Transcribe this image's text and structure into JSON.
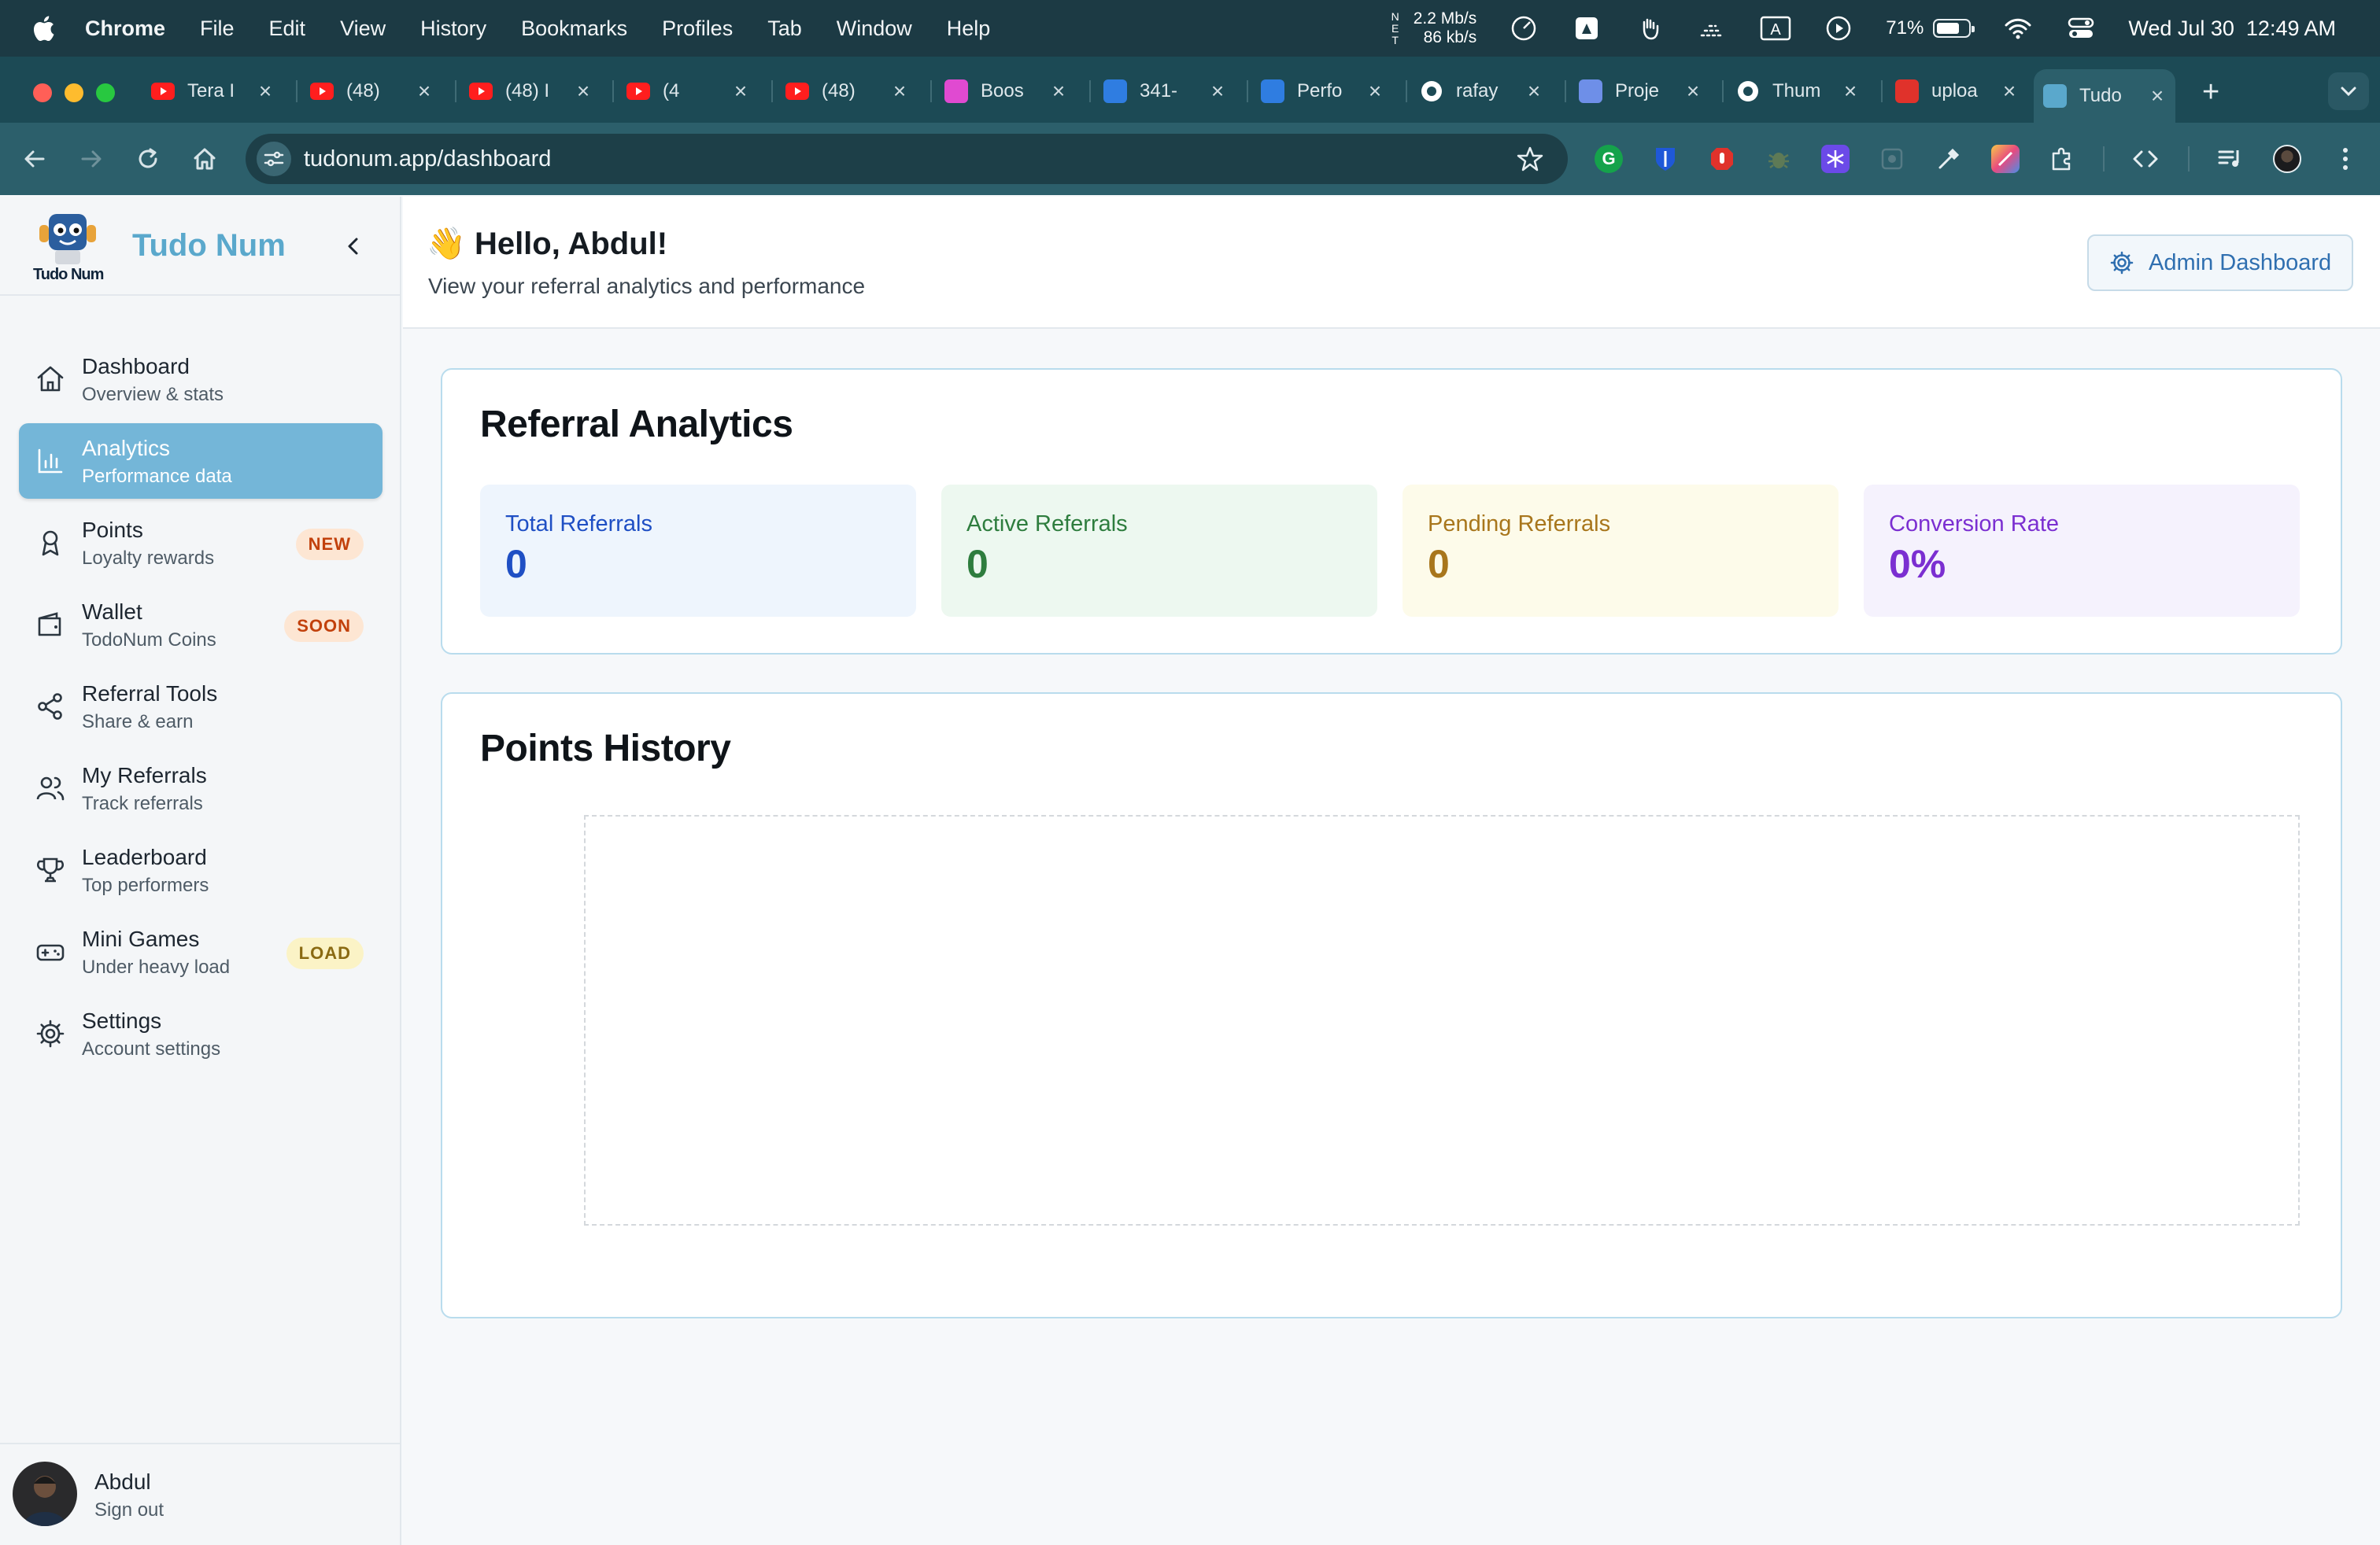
{
  "menubar": {
    "app": "Chrome",
    "items": [
      "File",
      "Edit",
      "View",
      "History",
      "Bookmarks",
      "Profiles",
      "Tab",
      "Window",
      "Help"
    ],
    "net_letters": "N\nE\nT",
    "net_down": "2.2 Mb/s",
    "net_up": "86 kb/s",
    "battery": "71%",
    "battery_level": 0.71,
    "datetime": "Wed Jul 30  12:49 AM"
  },
  "tabs": [
    {
      "title": "Tera I",
      "icon": "youtube-icon"
    },
    {
      "title": "(48) ",
      "icon": "youtube-icon"
    },
    {
      "title": "(48) I",
      "icon": "youtube-icon"
    },
    {
      "title": "(4",
      "icon": "youtube-icon"
    },
    {
      "title": "(48) ",
      "icon": "youtube-icon"
    },
    {
      "title": "Boos",
      "icon": "chat-bubble-icon"
    },
    {
      "title": "341-",
      "icon": "google-ads-icon"
    },
    {
      "title": "Perfo",
      "icon": "analytics-icon"
    },
    {
      "title": "rafay",
      "icon": "github-icon"
    },
    {
      "title": "Proje",
      "icon": "project-icon"
    },
    {
      "title": "Thum",
      "icon": "openai-icon"
    },
    {
      "title": "uploa",
      "icon": "upload-app-icon"
    },
    {
      "title": "Tudo",
      "icon": "tudonum-icon"
    }
  ],
  "toolbar": {
    "url": "tudonum.app/dashboard"
  },
  "sidebar": {
    "brand": "Tudo Num",
    "logo_text": "Tudo Num",
    "items": [
      {
        "title": "Dashboard",
        "subtitle": "Overview & stats",
        "icon": "home-icon",
        "badge": ""
      },
      {
        "title": "Analytics",
        "subtitle": "Performance data",
        "icon": "bar-chart-icon",
        "badge": ""
      },
      {
        "title": "Points",
        "subtitle": "Loyalty rewards",
        "icon": "award-icon",
        "badge": "NEW"
      },
      {
        "title": "Wallet",
        "subtitle": "TodoNum Coins",
        "icon": "wallet-icon",
        "badge": "SOON"
      },
      {
        "title": "Referral Tools",
        "subtitle": "Share & earn",
        "icon": "share-icon",
        "badge": ""
      },
      {
        "title": "My Referrals",
        "subtitle": "Track referrals",
        "icon": "users-icon",
        "badge": ""
      },
      {
        "title": "Leaderboard",
        "subtitle": "Top performers",
        "icon": "trophy-icon",
        "badge": ""
      },
      {
        "title": "Mini Games",
        "subtitle": "Under heavy load",
        "icon": "gamepad-icon",
        "badge": "LOAD"
      },
      {
        "title": "Settings",
        "subtitle": "Account settings",
        "icon": "gear-icon",
        "badge": ""
      }
    ],
    "user": {
      "name": "Abdul",
      "action": "Sign out"
    }
  },
  "header": {
    "greeting_emoji": "👋",
    "greeting": "Hello, Abdul!",
    "subtitle": "View your referral analytics and performance",
    "admin_button": "Admin Dashboard"
  },
  "referral_analytics": {
    "title": "Referral Analytics",
    "stats": [
      {
        "label": "Total Referrals",
        "value": "0"
      },
      {
        "label": "Active Referrals",
        "value": "0"
      },
      {
        "label": "Pending Referrals",
        "value": "0"
      },
      {
        "label": "Conversion Rate",
        "value": "0%"
      }
    ]
  },
  "points_history": {
    "title": "Points History"
  },
  "colors": {
    "menubar_bg": "#1c3a44",
    "tabstrip_bg": "#1c4a55",
    "toolbar_bg": "#2c5f6b",
    "brand": "#5aa8cc",
    "active_nav": "#74b6d8",
    "card_border": "#b9dced",
    "stat_blue_bg": "#eef5fd",
    "stat_blue_fg": "#1f4fc4",
    "stat_green_bg": "#edf8f0",
    "stat_green_fg": "#2e7d3e",
    "stat_yellow_bg": "#fdfbea",
    "stat_yellow_fg": "#a8761c",
    "stat_purple_bg": "#f5f2fd",
    "stat_purple_fg": "#7b2fd1",
    "badge_new_bg": "#fde6d3",
    "badge_new_fg": "#c2410c",
    "badge_soon_bg": "#fde6d3",
    "badge_soon_fg": "#c2410c",
    "badge_load_bg": "#fbf3c6",
    "badge_load_fg": "#8a6a12"
  }
}
